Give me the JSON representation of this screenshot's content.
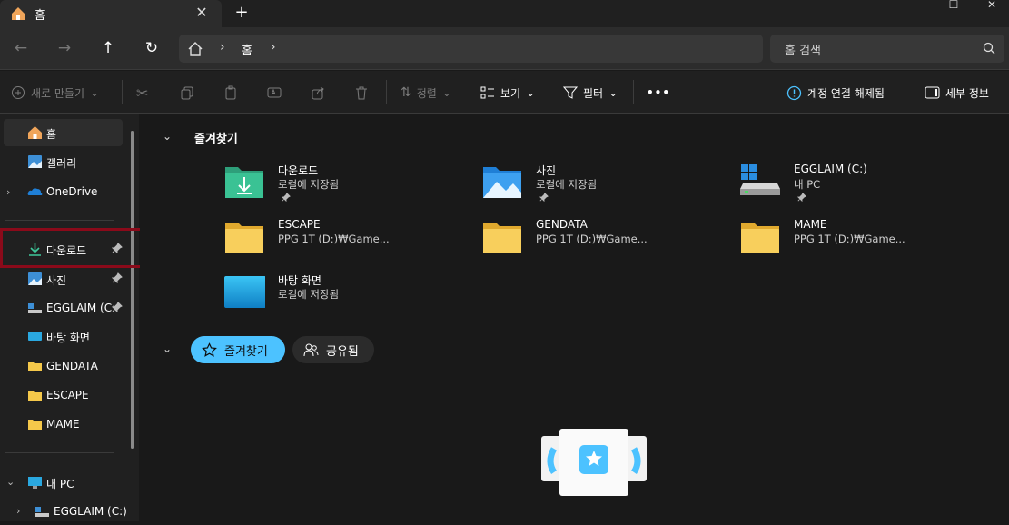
{
  "tab": {
    "title": "홈"
  },
  "window": {
    "minimize": "—",
    "maximize": "☐",
    "close": "✕"
  },
  "nav": {
    "breadcrumb": "홈",
    "search_placeholder": "홈 검색"
  },
  "toolbar": {
    "new_label": "새로 만들기",
    "sort_label": "정렬",
    "view_label": "보기",
    "filter_label": "필터",
    "more_label": "•••",
    "disconnect_label": "계정 연결 해제됨",
    "details_label": "세부 정보"
  },
  "sidebar": {
    "items": [
      {
        "label": "홈"
      },
      {
        "label": "갤러리"
      },
      {
        "label": "OneDrive"
      },
      {
        "label": "다운로드"
      },
      {
        "label": "사진"
      },
      {
        "label": "EGGLAIM (C:"
      },
      {
        "label": "바탕 화면"
      },
      {
        "label": "GENDATA"
      },
      {
        "label": "ESCAPE"
      },
      {
        "label": "MAME"
      },
      {
        "label": "내 PC"
      },
      {
        "label": "EGGLAIM (C:)"
      }
    ]
  },
  "main": {
    "section_title": "즐겨찾기",
    "quick_access": [
      {
        "name": "다운로드",
        "sub": "로컬에 저장됨"
      },
      {
        "name": "사진",
        "sub": "로컬에 저장됨"
      },
      {
        "name": "EGGLAIM (C:)",
        "sub": "내 PC"
      },
      {
        "name": "ESCAPE",
        "sub": "PPG 1T (D:)₩Game..."
      },
      {
        "name": "GENDATA",
        "sub": "PPG 1T (D:)₩Game..."
      },
      {
        "name": "MAME",
        "sub": "PPG 1T (D:)₩Game..."
      },
      {
        "name": "바탕 화면",
        "sub": "로컬에 저장됨"
      }
    ],
    "chips": {
      "favorites": "즐겨찾기",
      "shared": "공유됨"
    }
  },
  "colors": {
    "accent": "#4cc2ff",
    "folder": "#f5c84a",
    "highlight": "#8b0a1a"
  }
}
